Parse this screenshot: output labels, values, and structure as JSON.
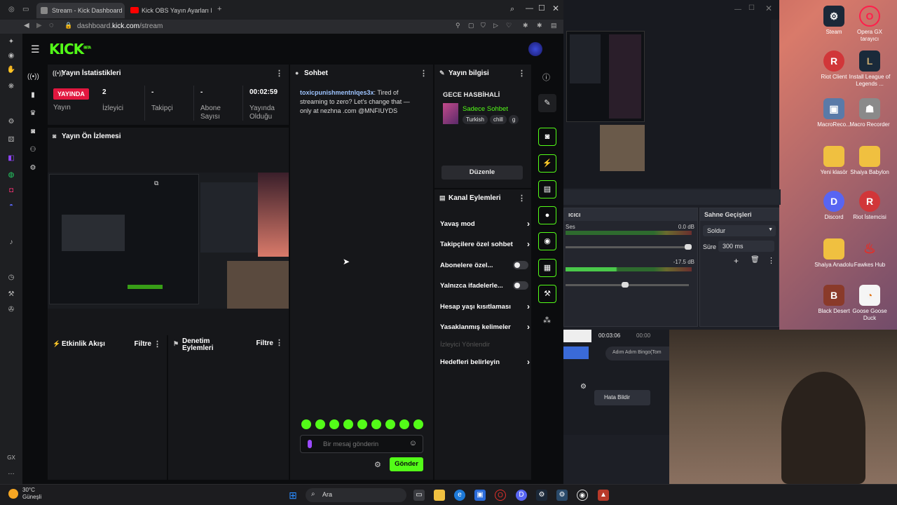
{
  "browser": {
    "tabs": [
      {
        "label": "Stream - Kick Dashboard"
      },
      {
        "label": "Kick OBS Yayın Ayarları N"
      }
    ],
    "url_host": "dashboard.",
    "url_domain": "kick.com",
    "url_path": "/stream"
  },
  "kick": {
    "logo": "KICK",
    "logo_sup": "BETA",
    "stats": {
      "title": "Yayın İstatistikleri",
      "live_badge": "YAYINDA",
      "live_label": "Yayın",
      "viewers_value": "2",
      "viewers_label": "İzleyici",
      "followers_value": "-",
      "followers_label": "Takipçi",
      "subs_value": "-",
      "subs_label": "Abone Sayısı",
      "uptime_value": "00:02:59",
      "uptime_label": "Yayında Olduğu"
    },
    "preview": {
      "title": "Yayın Ön İzlemesi"
    },
    "activity": {
      "title": "Etkinlik Akışı",
      "filter": "Filtre"
    },
    "moderation": {
      "title": "Denetim Eylemleri",
      "filter": "Filtre"
    },
    "chat": {
      "title": "Sohbet",
      "username": "toxicpunishmentnlqes3x",
      "message": ": Tired of streaming to zero? Let's change that — only at nezhna .com @MNFIUYDS",
      "input_placeholder": "Bir mesaj gönderin",
      "send_label": "Gönder"
    },
    "stream_info": {
      "title": "Yayın bilgisi",
      "stream_title": "GECE HASBİHALİ",
      "category": "Sadece Sohbet",
      "tags": [
        "Turkish",
        "chill",
        "g"
      ],
      "edit_label": "Düzenle"
    },
    "channel_actions": {
      "title": "Kanal Eylemleri",
      "items": [
        {
          "label": "Yavaş mod"
        },
        {
          "label": "Takipçilere özel sohbet"
        },
        {
          "label": "Abonelere özel..."
        },
        {
          "label": "Yalnızca ifadelerle..."
        },
        {
          "label": "Hesap yaşı kısıtlaması"
        },
        {
          "label": "Yasaklanmış kelimeler"
        },
        {
          "label": "İzleyici Yönlendir"
        },
        {
          "label": "Hedefleri belirleyin"
        }
      ]
    }
  },
  "obs": {
    "mixer_title": "ıcıcı",
    "mic_label": "Ses",
    "db1": "0.0 dB",
    "db2": "-17.5 dB",
    "transitions_title": "Sahne Geçişleri",
    "transition_value": "Soldur",
    "duration_label": "Süre",
    "duration_value": "300 ms",
    "timer1": "00:03:06",
    "timer2": "00:00",
    "bingo_text": "Adım Adım Bingo(Tom",
    "report_label": "Hata Bildir"
  },
  "desktop_icons": [
    {
      "label": "Steam"
    },
    {
      "label": "Opera GX tarayıcı"
    },
    {
      "label": "Riot Client"
    },
    {
      "label": "Install League of Legends ..."
    },
    {
      "label": "MacroReco..."
    },
    {
      "label": "Macro Recorder"
    },
    {
      "label": "Yeni klasör"
    },
    {
      "label": "Shaiya Babylon"
    },
    {
      "label": "Discord"
    },
    {
      "label": "Riot İstemcisi"
    },
    {
      "label": "Shaiya Anadolu"
    },
    {
      "label": "Fawkes Hub"
    },
    {
      "label": "Black Desert"
    },
    {
      "label": "Goose Goose Duck"
    }
  ],
  "taskbar": {
    "weather_temp": "30°C",
    "weather_desc": "Güneşli",
    "search_label": "Ara"
  },
  "sidebar_bottom_label": "GX",
  "colors": {
    "kick_green": "#53fc18",
    "live_red": "#e2173f"
  }
}
